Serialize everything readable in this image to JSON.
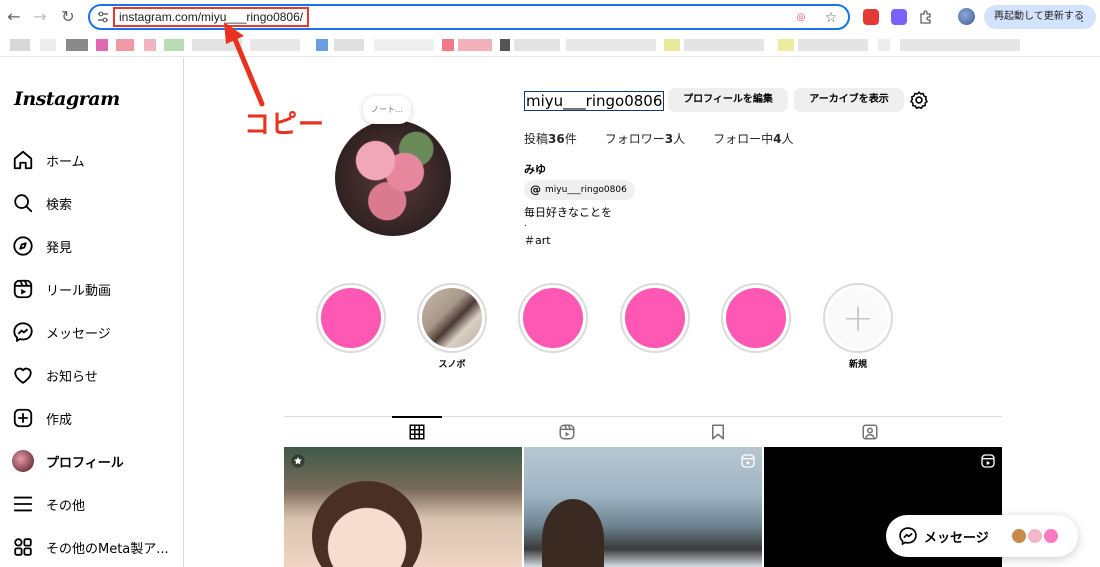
{
  "browser": {
    "url": "instagram.com/miyu___ringo0806/",
    "restart_label": "再起動して更新する",
    "menu_glyph": "⋮"
  },
  "annotation": {
    "label": "コピー",
    "color": "#e8321f"
  },
  "sidebar": {
    "logo": "Instagram",
    "items": [
      {
        "label": "ホーム",
        "icon": "home-icon"
      },
      {
        "label": "検索",
        "icon": "search-icon"
      },
      {
        "label": "発見",
        "icon": "compass-icon"
      },
      {
        "label": "リール動画",
        "icon": "reels-icon"
      },
      {
        "label": "メッセージ",
        "icon": "messenger-icon"
      },
      {
        "label": "お知らせ",
        "icon": "heart-icon"
      },
      {
        "label": "作成",
        "icon": "plus-square-icon"
      },
      {
        "label": "プロフィール",
        "icon": "avatar"
      },
      {
        "label": "その他",
        "icon": "menu-icon"
      },
      {
        "label": "その他のMeta製ア...",
        "icon": "apps-icon"
      }
    ]
  },
  "profile": {
    "note": "ノート...",
    "username": "miyu___ringo0806",
    "edit_button": "プロフィールを編集",
    "archive_button": "アーカイブを表示",
    "stats": {
      "posts_label": "投稿",
      "posts_count": "36",
      "posts_unit": "件",
      "followers_label": "フォロワー",
      "followers_count": "3",
      "followers_unit": "人",
      "following_label": "フォロー中",
      "following_count": "4",
      "following_unit": "人"
    },
    "full_name": "みゆ",
    "threads_handle": "miyu___ringo0806",
    "bio_line1": "毎日好きなことを",
    "bio_line2": ".",
    "bio_line3": "＃art",
    "accent_pink": "#ff57b4"
  },
  "highlights": [
    {
      "caption": "",
      "style": "pink"
    },
    {
      "caption": "スノボ",
      "style": "photo"
    },
    {
      "caption": "",
      "style": "pink"
    },
    {
      "caption": "",
      "style": "pink"
    },
    {
      "caption": "",
      "style": "pink"
    },
    {
      "caption": "新規",
      "style": "new",
      "glyph": "+"
    }
  ],
  "tabs": [
    {
      "icon": "grid-icon",
      "active": true
    },
    {
      "icon": "reels-icon",
      "active": false
    },
    {
      "icon": "bookmark-icon",
      "active": false
    },
    {
      "icon": "tagged-icon",
      "active": false
    }
  ],
  "messages_bubble": {
    "label": "メッセージ"
  }
}
